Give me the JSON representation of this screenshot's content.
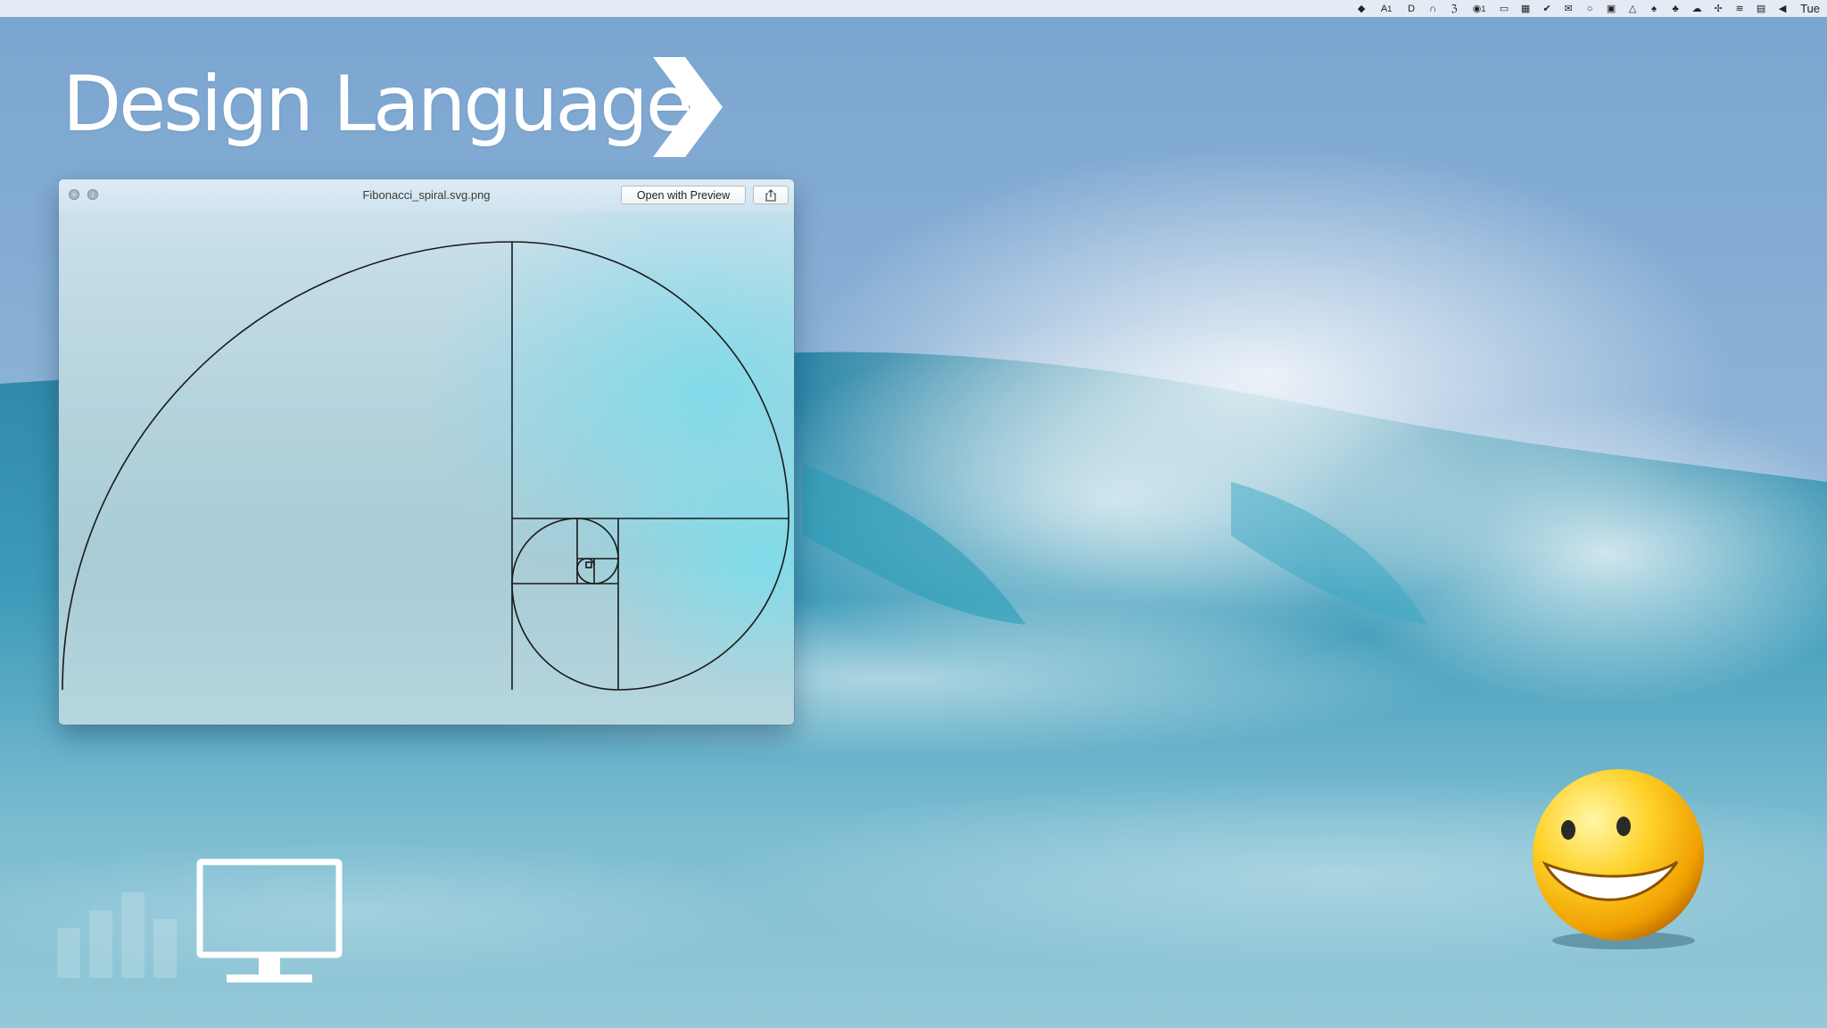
{
  "menubar": {
    "icons": [
      "dropbox-icon",
      "adobe-icon",
      "dash-icon",
      "headphones-icon",
      "script-icon",
      "network-icon",
      "display-icon",
      "calendar-icon",
      "tasks-icon",
      "mail-icon",
      "search-icon",
      "window-icon",
      "drive-icon",
      "notifications-icon",
      "evernote-icon",
      "cloud-icon",
      "bluetooth-icon",
      "wifi-icon",
      "flag-icon",
      "volume-icon"
    ],
    "badge_adobe": "1",
    "badge_network": "1",
    "clock": "Tue"
  },
  "slide": {
    "title": "Design Language"
  },
  "quicklook": {
    "filename": "Fibonacci_spiral.svg.png",
    "open_button_label": "Open with Preview",
    "share_icon": "share-icon",
    "close_icon": "close-icon",
    "fullscreen_icon": "fullscreen-icon"
  },
  "desktop": {
    "icons": [
      "monitor-icon",
      "smiley-icon"
    ]
  },
  "colors": {
    "menubar": "#ECF0F6",
    "title_text": "#FFFFFF",
    "ocean_deep": "#2F8FB0",
    "smiley_yellow": "#F5B800"
  }
}
